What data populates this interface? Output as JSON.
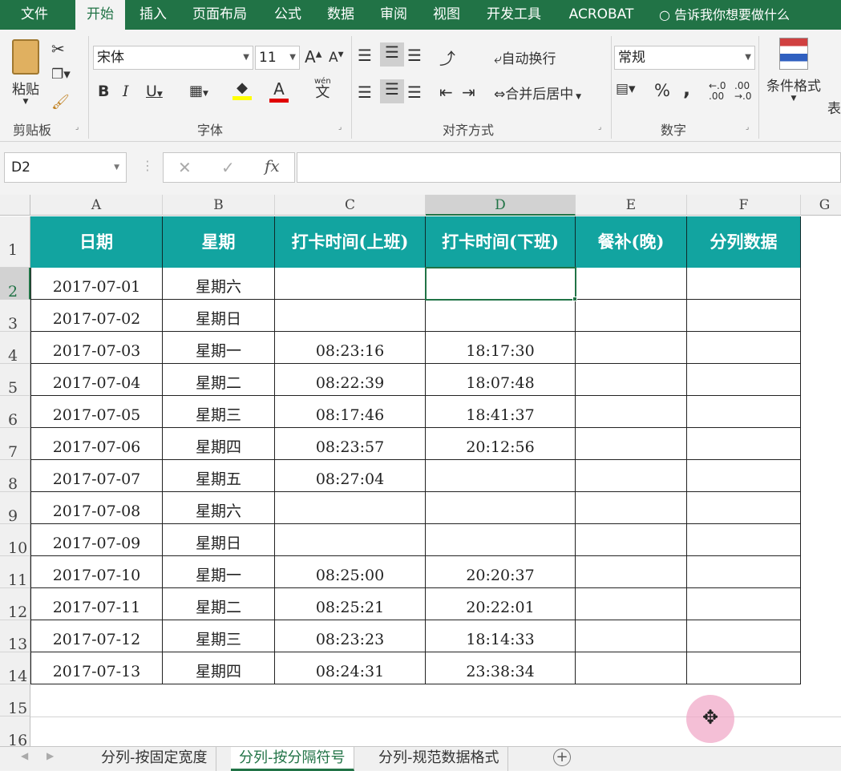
{
  "tabs": [
    "文件",
    "开始",
    "插入",
    "页面布局",
    "公式",
    "数据",
    "审阅",
    "视图",
    "开发工具",
    "ACROBAT"
  ],
  "tell_me": "告诉我你想要做什么",
  "ribbon": {
    "clipboard": {
      "label": "剪贴板",
      "paste": "粘贴"
    },
    "font": {
      "label": "字体",
      "font_name": "宋体",
      "font_size": "11",
      "bold": "B",
      "italic": "I",
      "underline": "U",
      "grow": "A",
      "shrink": "A",
      "font_color": "A",
      "phonetic": "文",
      "phonetic_top": "wén"
    },
    "alignment": {
      "label": "对齐方式",
      "wrap": "自动换行",
      "merge": "合并后居中"
    },
    "number": {
      "label": "数字",
      "format": "常规",
      "percent": "%",
      "comma": ","
    },
    "styles": {
      "conditional": "条件格式",
      "table_partial": "表"
    }
  },
  "formula_bar": {
    "name_box": "D2",
    "fx": "fx",
    "cancel": "✕",
    "enter": "✓",
    "value": ""
  },
  "columns": [
    "A",
    "B",
    "C",
    "D",
    "E",
    "F",
    "G"
  ],
  "rows": [
    "1",
    "2",
    "3",
    "4",
    "5",
    "6",
    "7",
    "8",
    "9",
    "10",
    "11",
    "12",
    "13",
    "14",
    "15",
    "16"
  ],
  "headers": [
    "日期",
    "星期",
    "打卡时间(上班)",
    "打卡时间(下班)",
    "餐补(晚)",
    "分列数据"
  ],
  "data": [
    [
      "2017-07-01",
      "星期六",
      "",
      ""
    ],
    [
      "2017-07-02",
      "星期日",
      "",
      ""
    ],
    [
      "2017-07-03",
      "星期一",
      "08:23:16",
      "18:17:30"
    ],
    [
      "2017-07-04",
      "星期二",
      "08:22:39",
      "18:07:48"
    ],
    [
      "2017-07-05",
      "星期三",
      "08:17:46",
      "18:41:37"
    ],
    [
      "2017-07-06",
      "星期四",
      "08:23:57",
      "20:12:56"
    ],
    [
      "2017-07-07",
      "星期五",
      "08:27:04",
      ""
    ],
    [
      "2017-07-08",
      "星期六",
      "",
      ""
    ],
    [
      "2017-07-09",
      "星期日",
      "",
      ""
    ],
    [
      "2017-07-10",
      "星期一",
      "08:25:00",
      "20:20:37"
    ],
    [
      "2017-07-11",
      "星期二",
      "08:25:21",
      "20:22:01"
    ],
    [
      "2017-07-12",
      "星期三",
      "08:23:23",
      "18:14:33"
    ],
    [
      "2017-07-13",
      "星期四",
      "08:24:31",
      "23:38:34"
    ]
  ],
  "sheet_tabs": [
    "分列-按固定宽度",
    "分列-按分隔符号",
    "分列-规范数据格式"
  ],
  "active_sheet": "分列-按分隔符号",
  "add_sheet": "+",
  "colors": {
    "ribbon_green": "#217346",
    "header_teal": "#12a4a0"
  }
}
